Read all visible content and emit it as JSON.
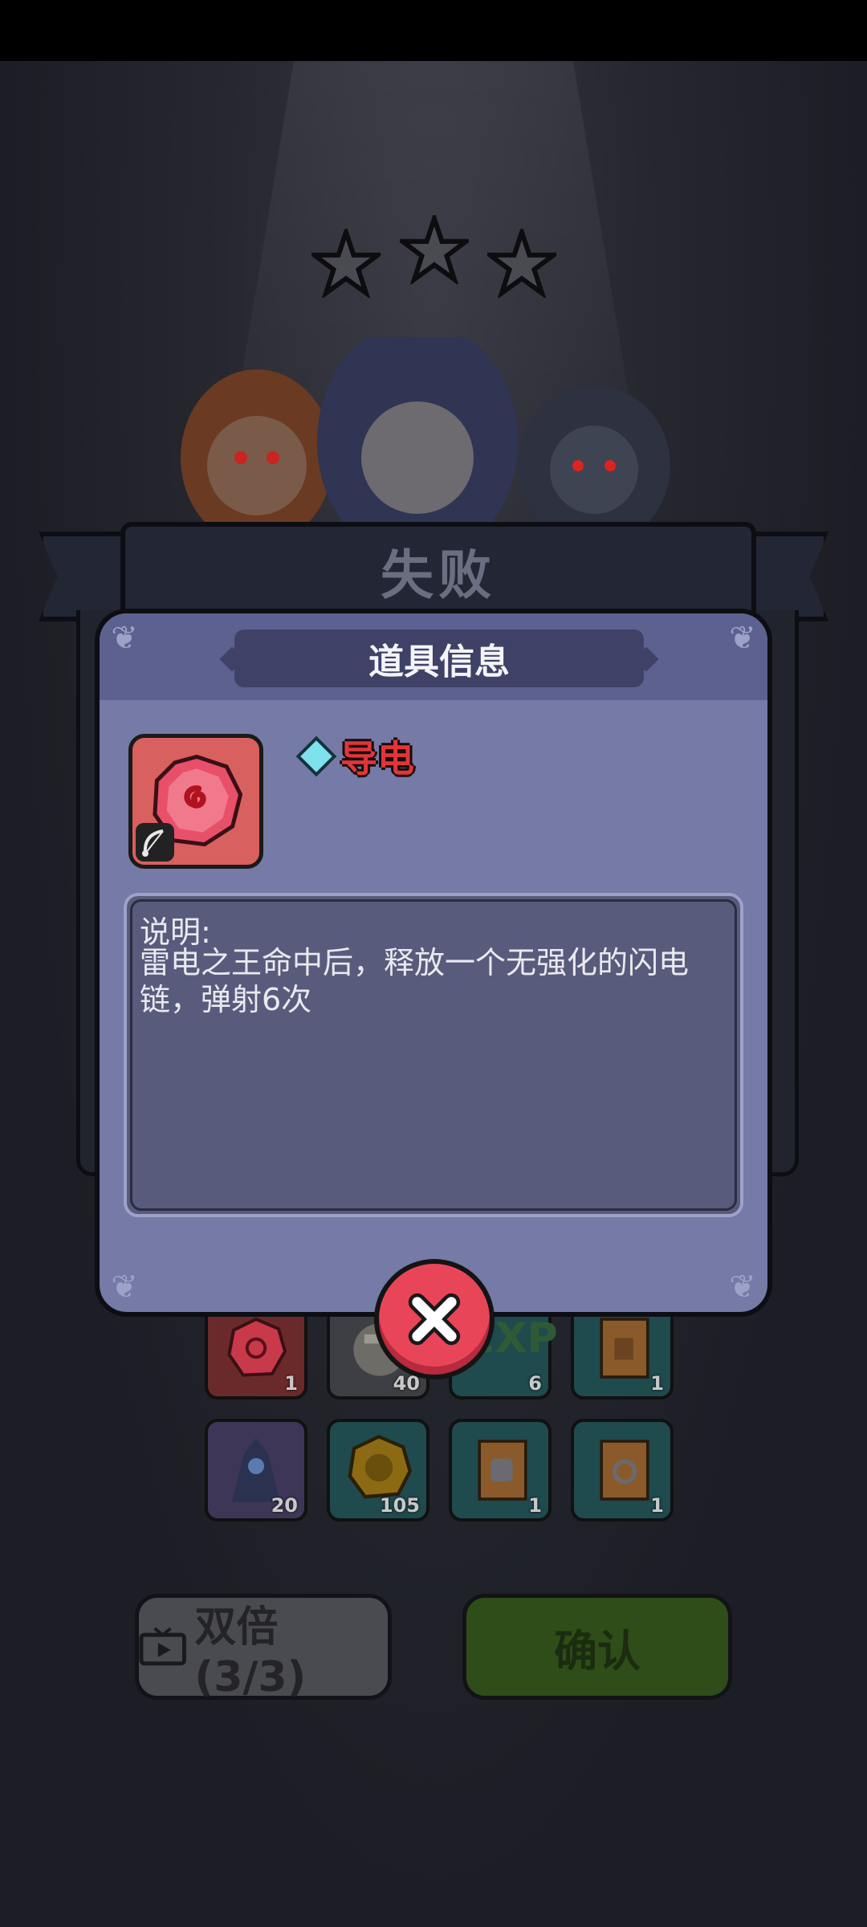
{
  "banner": {
    "title": "失败"
  },
  "rewards": {
    "row1": [
      {
        "icon": "lightning-gem-icon",
        "count": "1"
      },
      {
        "icon": "hero-portrait-icon",
        "count": "40"
      },
      {
        "icon": "exp-icon",
        "label": "EXP",
        "count": "6"
      },
      {
        "icon": "boots-banner-icon",
        "count": "1"
      }
    ],
    "row2": [
      {
        "icon": "dark-hero-portrait-icon",
        "count": "20"
      },
      {
        "icon": "gold-coin-icon",
        "count": "105"
      },
      {
        "icon": "armor-banner-icon",
        "count": "1"
      },
      {
        "icon": "ring-banner-icon",
        "count": "1"
      }
    ]
  },
  "buttons": {
    "double_label": "双倍(3/3)",
    "confirm_label": "确认"
  },
  "dialog": {
    "title": "道具信息",
    "item_name": "导电",
    "desc_label": "说明:",
    "desc_text": "雷电之王命中后，释放一个无强化的闪电链，弹射6次"
  },
  "colors": {
    "dialog_bg": "#757aa6",
    "item_name": "#e0363a",
    "close_button": "#e84658",
    "confirm_button": "#2e4d18"
  }
}
